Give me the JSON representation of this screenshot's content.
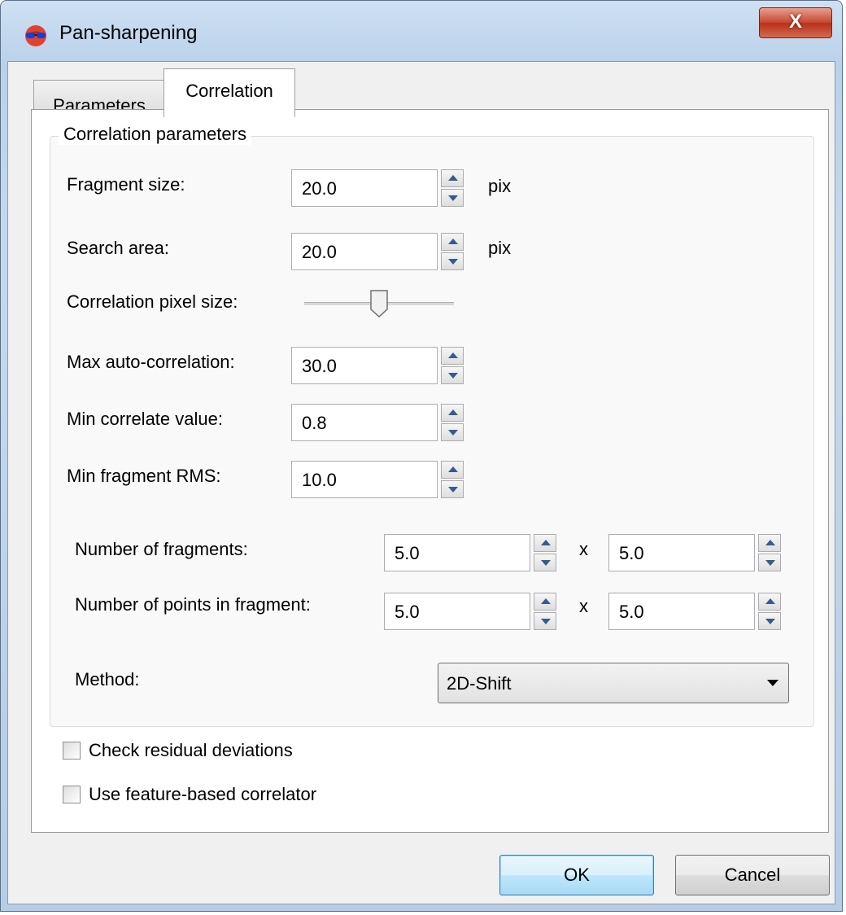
{
  "window": {
    "title": "Pan-sharpening",
    "close_glyph": "X"
  },
  "tabs": [
    {
      "label": "Parameters",
      "active": false
    },
    {
      "label": "Correlation",
      "active": true
    }
  ],
  "group": {
    "title": "Correlation parameters",
    "fragment_size": {
      "label": "Fragment size:",
      "value": "20.0",
      "unit": "pix"
    },
    "search_area": {
      "label": "Search area:",
      "value": "20.0",
      "unit": "pix"
    },
    "pixel_size": {
      "label": "Correlation pixel size:",
      "slider_level": 0.5
    },
    "max_auto": {
      "label": "Max auto-correlation:",
      "value": "30.0"
    },
    "min_correlate": {
      "label": "Min correlate value:",
      "value": "0.8"
    },
    "min_rms": {
      "label": "Min fragment RMS:",
      "value": "10.0"
    },
    "num_fragments": {
      "label": "Number of fragments:",
      "value_x": "5.0",
      "value_y": "5.0",
      "sep": "x"
    },
    "num_points": {
      "label": "Number of points in fragment:",
      "value_x": "5.0",
      "value_y": "5.0",
      "sep": "x"
    },
    "method": {
      "label": "Method:",
      "value": "2D-Shift"
    }
  },
  "checkboxes": {
    "residual": {
      "label": "Check residual deviations",
      "checked": false
    },
    "feature": {
      "label": "Use feature-based correlator",
      "checked": false
    }
  },
  "buttons": {
    "ok": "OK",
    "cancel": "Cancel"
  }
}
